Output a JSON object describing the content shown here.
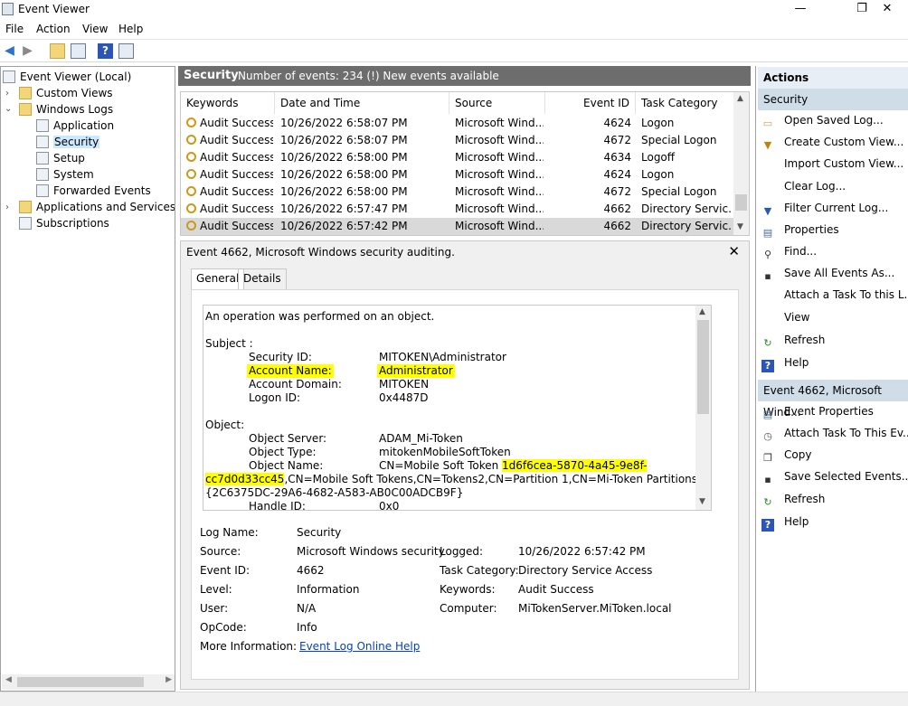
{
  "window": {
    "title": "Event Viewer",
    "minimize": "—",
    "maximize": "❐",
    "close": "✕"
  },
  "menu": [
    "File",
    "Action",
    "View",
    "Help"
  ],
  "tree": {
    "root": "Event Viewer (Local)",
    "custom_views": "Custom Views",
    "windows_logs": "Windows Logs",
    "application": "Application",
    "security": "Security",
    "setup": "Setup",
    "system": "System",
    "forwarded": "Forwarded Events",
    "apps_services": "Applications and Services Lo",
    "subscriptions": "Subscriptions"
  },
  "center_header": {
    "title": "Security",
    "info": "Number of events: 234 (!) New events available"
  },
  "grid": {
    "columns": [
      "Keywords",
      "Date and Time",
      "Source",
      "Event ID",
      "Task Category"
    ],
    "rows": [
      [
        "Audit Success",
        "10/26/2022 6:58:07 PM",
        "Microsoft Wind...",
        "4624",
        "Logon"
      ],
      [
        "Audit Success",
        "10/26/2022 6:58:07 PM",
        "Microsoft Wind...",
        "4672",
        "Special Logon"
      ],
      [
        "Audit Success",
        "10/26/2022 6:58:00 PM",
        "Microsoft Wind...",
        "4634",
        "Logoff"
      ],
      [
        "Audit Success",
        "10/26/2022 6:58:00 PM",
        "Microsoft Wind...",
        "4624",
        "Logon"
      ],
      [
        "Audit Success",
        "10/26/2022 6:58:00 PM",
        "Microsoft Wind...",
        "4672",
        "Special Logon"
      ],
      [
        "Audit Success",
        "10/26/2022 6:57:47 PM",
        "Microsoft Wind...",
        "4662",
        "Directory Servic..."
      ],
      [
        "Audit Success",
        "10/26/2022 6:57:42 PM",
        "Microsoft Wind...",
        "4662",
        "Directory Servic..."
      ]
    ]
  },
  "detail": {
    "title": "Event 4662, Microsoft Windows security auditing.",
    "tabs": [
      "General",
      "Details"
    ],
    "message": {
      "intro": "An operation was performed on an object.",
      "subject_label": "Subject :",
      "security_id_k": "Security ID:",
      "security_id_v": "MITOKEN\\Administrator",
      "account_name_k": "Account Name:",
      "account_name_v": "Administrator",
      "account_domain_k": "Account Domain:",
      "account_domain_v": "MITOKEN",
      "logon_id_k": "Logon ID:",
      "logon_id_v": "0x4487D",
      "object_label": "Object:",
      "object_server_k": "Object Server:",
      "object_server_v": "ADAM_Mi-Token",
      "object_type_k": "Object Type:",
      "object_type_v": "mitokenMobileSoftToken",
      "object_name_k": "Object Name:",
      "object_name_v_pre": "CN=Mobile Soft Token ",
      "object_name_v_hl": "1d6f6cea-5870-4a45-9e8f-",
      "object_name_line2_hl": "cc7d0d33cc45",
      "object_name_line2_rest": ",CN=Mobile Soft Tokens,CN=Tokens2,CN=Partition 1,CN=Mi-Token Partitions,CN=",
      "object_name_line3": "{2C6375DC-29A6-4682-A583-AB0C00ADCB9F}",
      "handle_id_k": "Handle ID:",
      "handle_id_v": "0x0"
    },
    "fields": {
      "log_name_k": "Log Name:",
      "log_name_v": "Security",
      "source_k": "Source:",
      "source_v": "Microsoft Windows security",
      "logged_k": "Logged:",
      "logged_v": "10/26/2022 6:57:42 PM",
      "event_id_k": "Event ID:",
      "event_id_v": "4662",
      "task_cat_k": "Task Category:",
      "task_cat_v": "Directory Service Access",
      "level_k": "Level:",
      "level_v": "Information",
      "keywords_k": "Keywords:",
      "keywords_v": "Audit Success",
      "user_k": "User:",
      "user_v": "N/A",
      "computer_k": "Computer:",
      "computer_v": "MiTokenServer.MiToken.local",
      "opcode_k": "OpCode:",
      "opcode_v": "Info",
      "more_info_k": "More Information:",
      "more_info_v": "Event Log Online Help"
    }
  },
  "actions": {
    "header": "Actions",
    "section1": "Security",
    "items1": [
      "Open Saved Log...",
      "Create Custom View...",
      "Import Custom View...",
      "Clear Log...",
      "Filter Current Log...",
      "Properties",
      "Find...",
      "Save All Events As...",
      "Attach a Task To this L...",
      "View",
      "Refresh",
      "Help"
    ],
    "section2": "Event 4662, Microsoft Wind...",
    "items2": [
      "Event Properties",
      "Attach Task To This Ev...",
      "Copy",
      "Save Selected Events...",
      "Refresh",
      "Help"
    ]
  }
}
